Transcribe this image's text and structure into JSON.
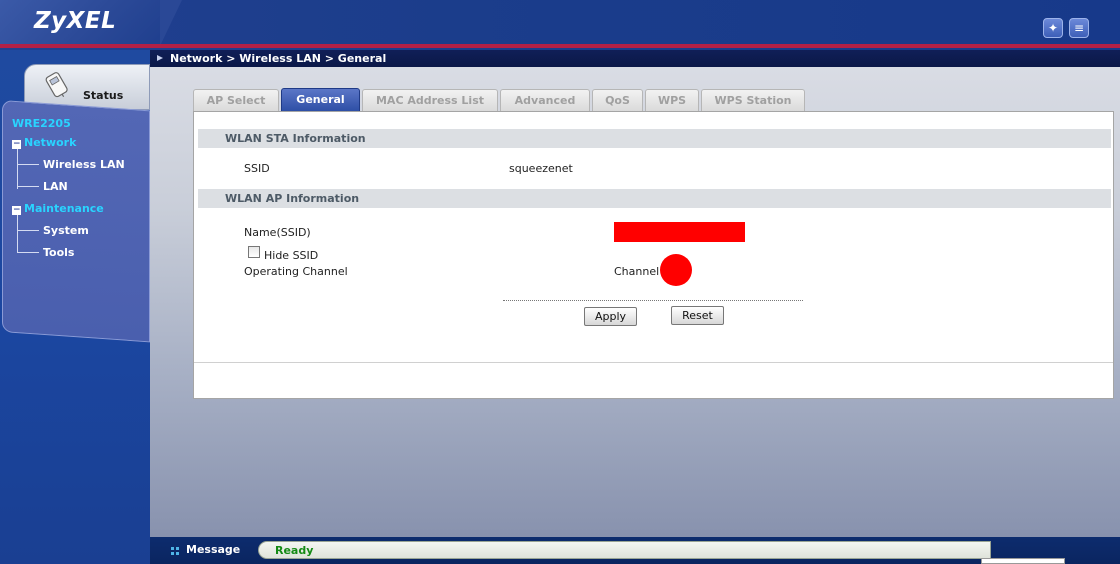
{
  "brand": {
    "logo_text": "ZyXEL"
  },
  "header": {
    "icons": [
      "wizard-icon",
      "logout-icon"
    ]
  },
  "sidebar": {
    "status_label": "Status",
    "model": "WRE2205",
    "tree": [
      {
        "label": "Network",
        "expanded": true,
        "children": [
          "Wireless LAN",
          "LAN"
        ]
      },
      {
        "label": "Maintenance",
        "expanded": true,
        "children": [
          "System",
          "Tools"
        ]
      }
    ]
  },
  "breadcrumb": "Network > Wireless LAN > General",
  "tabs": [
    {
      "label": "AP Select",
      "active": false
    },
    {
      "label": "General",
      "active": true
    },
    {
      "label": "MAC Address List",
      "active": false
    },
    {
      "label": "Advanced",
      "active": false
    },
    {
      "label": "QoS",
      "active": false
    },
    {
      "label": "WPS",
      "active": false
    },
    {
      "label": "WPS Station",
      "active": false
    }
  ],
  "sta_info": {
    "title": "WLAN STA Information",
    "ssid_label": "SSID",
    "ssid_value": "squeezenet"
  },
  "ap_info": {
    "title": "WLAN AP Information",
    "name_label": "Name(SSID)",
    "hide_ssid_label": "Hide SSID",
    "hide_ssid_checked": false,
    "channel_label": "Operating Channel",
    "channel_value": "Channel"
  },
  "buttons": {
    "apply": "Apply",
    "reset": "Reset"
  },
  "message": {
    "label": "Message",
    "status": "Ready"
  },
  "colors": {
    "accent_line": "#b32046",
    "active_tab": "#2e4fa6",
    "tree_cyan": "#29d4ff",
    "status_green": "#148a14",
    "redaction": "#ff0000"
  }
}
